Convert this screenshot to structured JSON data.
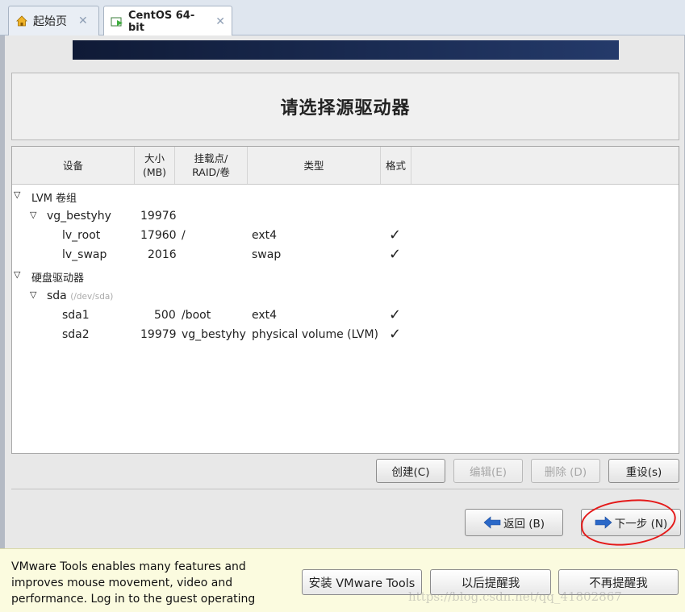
{
  "tabs": [
    {
      "label": "起始页",
      "icon": "home-icon"
    },
    {
      "label": "CentOS 64-bit",
      "icon": "vm-icon"
    }
  ],
  "page_title": "请选择源驱动器",
  "columns": {
    "device": "设备",
    "size_line1": "大小",
    "size_line2": "(MB)",
    "mount_line1": "挂载点/",
    "mount_line2": "RAID/卷",
    "type": "类型",
    "format": "格式"
  },
  "rows": [
    {
      "device": "LVM 卷组",
      "size": "",
      "mount": "",
      "type": "",
      "format": false,
      "level": 0,
      "expanded": true
    },
    {
      "device": "vg_bestyhy",
      "size": "19976",
      "mount": "",
      "type": "",
      "format": false,
      "level": 1,
      "expanded": true
    },
    {
      "device": "lv_root",
      "size": "17960",
      "mount": "/",
      "type": "ext4",
      "format": true,
      "level": 2
    },
    {
      "device": "lv_swap",
      "size": "2016",
      "mount": "",
      "type": "swap",
      "format": true,
      "level": 2
    },
    {
      "device": "硬盘驱动器",
      "size": "",
      "mount": "",
      "type": "",
      "format": false,
      "level": 0,
      "expanded": true
    },
    {
      "device": "sda",
      "device_path": "(/dev/sda)",
      "size": "",
      "mount": "",
      "type": "",
      "format": false,
      "level": 1,
      "expanded": true
    },
    {
      "device": "sda1",
      "size": "500",
      "mount": "/boot",
      "type": "ext4",
      "format": true,
      "level": 2
    },
    {
      "device": "sda2",
      "size": "19979",
      "mount": "vg_bestyhy",
      "type": "physical volume (LVM)",
      "format": true,
      "level": 2
    }
  ],
  "table_buttons": {
    "create": "创建(C)",
    "edit": "编辑(E)",
    "delete": "删除 (D)",
    "reset": "重设(s)"
  },
  "nav": {
    "back": "返回 (B)",
    "next": "下一步 (N)"
  },
  "notice": {
    "message": "VMware Tools enables many features and improves mouse movement, video and performance. Log in to the guest operating",
    "install": "安装 VMware Tools",
    "remind_later": "以后提醒我",
    "never_remind": "不再提醒我"
  },
  "watermark": "https://blog.csdn.net/qq_41802867",
  "colors": {
    "check": "#222222",
    "annotation": "#e41a1a",
    "nav_arrow": "#2a68c8"
  }
}
